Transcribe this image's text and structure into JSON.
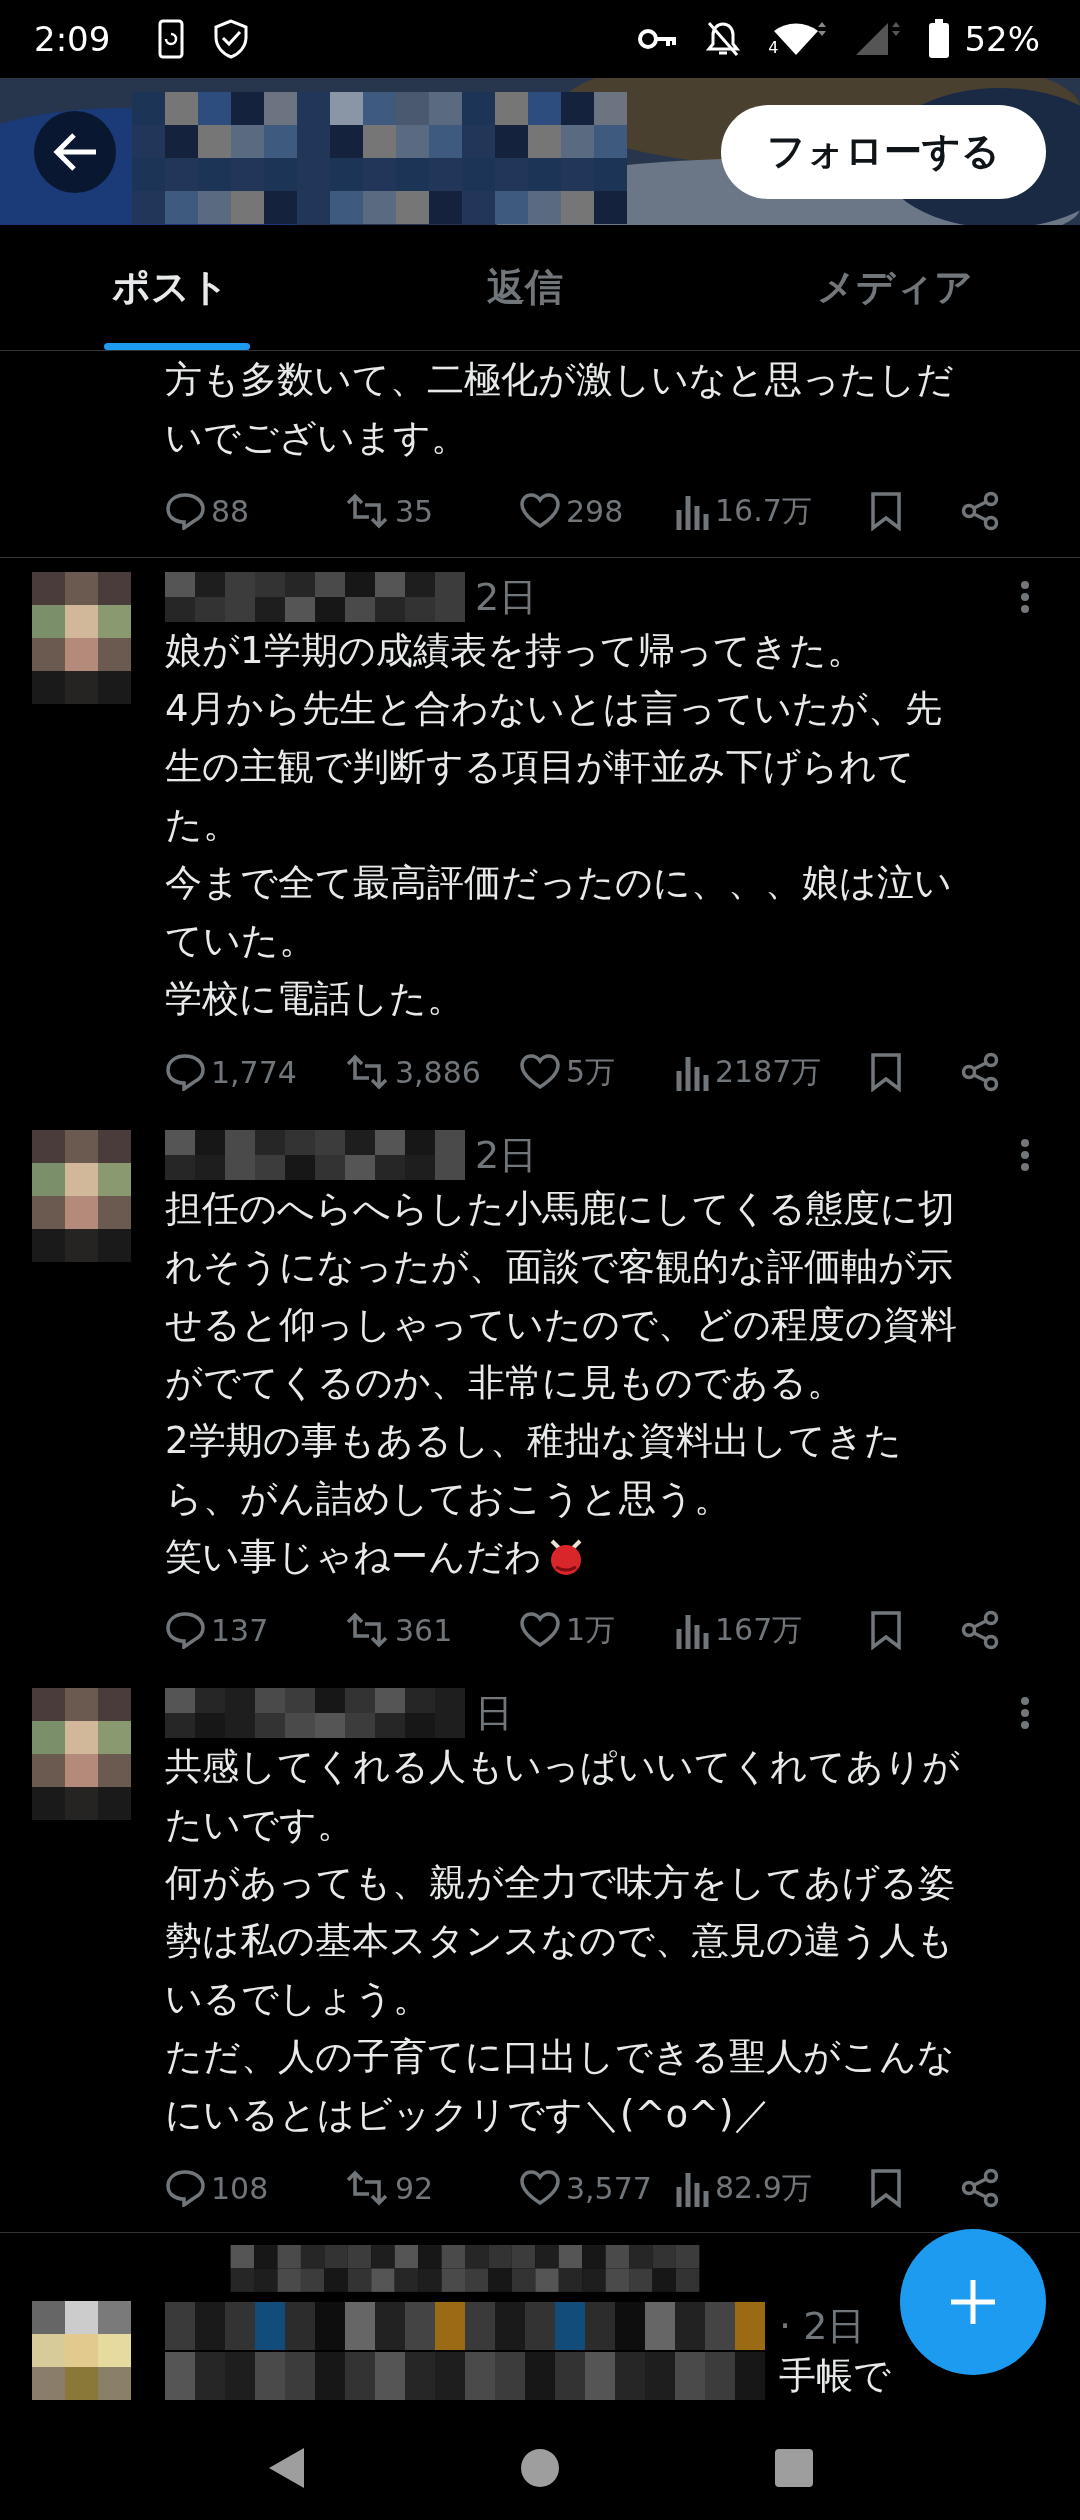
{
  "status_bar": {
    "time": "2:09",
    "network_label": "4",
    "battery": "52%"
  },
  "header": {
    "follow_button": "フォローする"
  },
  "tabs": [
    {
      "label": "ポスト",
      "selected": true
    },
    {
      "label": "返信",
      "selected": false
    },
    {
      "label": "メディア",
      "selected": false
    }
  ],
  "posts": [
    {
      "kind": "continued",
      "lines": [
        "方も多数いて、二極化が激しいなと思ったしだ",
        "いでございます。"
      ],
      "stats": {
        "replies": "88",
        "reposts": "35",
        "likes": "298",
        "views": "16.7万"
      }
    },
    {
      "kind": "full",
      "time": "2日",
      "lines": [
        "娘が1学期の成績表を持って帰ってきた。",
        "4月から先生と合わないとは言っていたが、先",
        "生の主観で判断する項目が軒並み下げられて",
        "た。",
        "今まで全て最高評価だったのに、、、娘は泣い",
        "ていた。",
        "学校に電話した。"
      ],
      "stats": {
        "replies": "1,774",
        "reposts": "3,886",
        "likes": "5万",
        "views": "2187万"
      }
    },
    {
      "kind": "full",
      "time": "2日",
      "trailing_emoji": true,
      "lines": [
        "担任のへらへらした小馬鹿にしてくる態度に切",
        "れそうになったが、面談で客観的な評価軸が示",
        "せると仰っしゃっていたので、どの程度の資料",
        "がでてくるのか、非常に見ものである。",
        "2学期の事もあるし、稚拙な資料出してきた",
        "ら、がん詰めしておこうと思う。",
        "笑い事じゃねーんだわ"
      ],
      "stats": {
        "replies": "137",
        "reposts": "361",
        "likes": "1万",
        "views": "167万"
      }
    },
    {
      "kind": "full",
      "time": "日",
      "lines": [
        "共感してくれる人もいっぱいいてくれてありが",
        "たいです。",
        "何があっても、親が全力で味方をしてあげる姿",
        "勢は私の基本スタンスなので、意見の違う人も",
        "いるでしょう。",
        "ただ、人の子育てに口出しできる聖人がこんな",
        "にいるとはビックリです＼(^o^)／"
      ],
      "stats": {
        "replies": "108",
        "reposts": "92",
        "likes": "3,577",
        "views": "82.9万"
      }
    }
  ],
  "partial_post": {
    "time": "· 2日",
    "text": "手帳で"
  }
}
